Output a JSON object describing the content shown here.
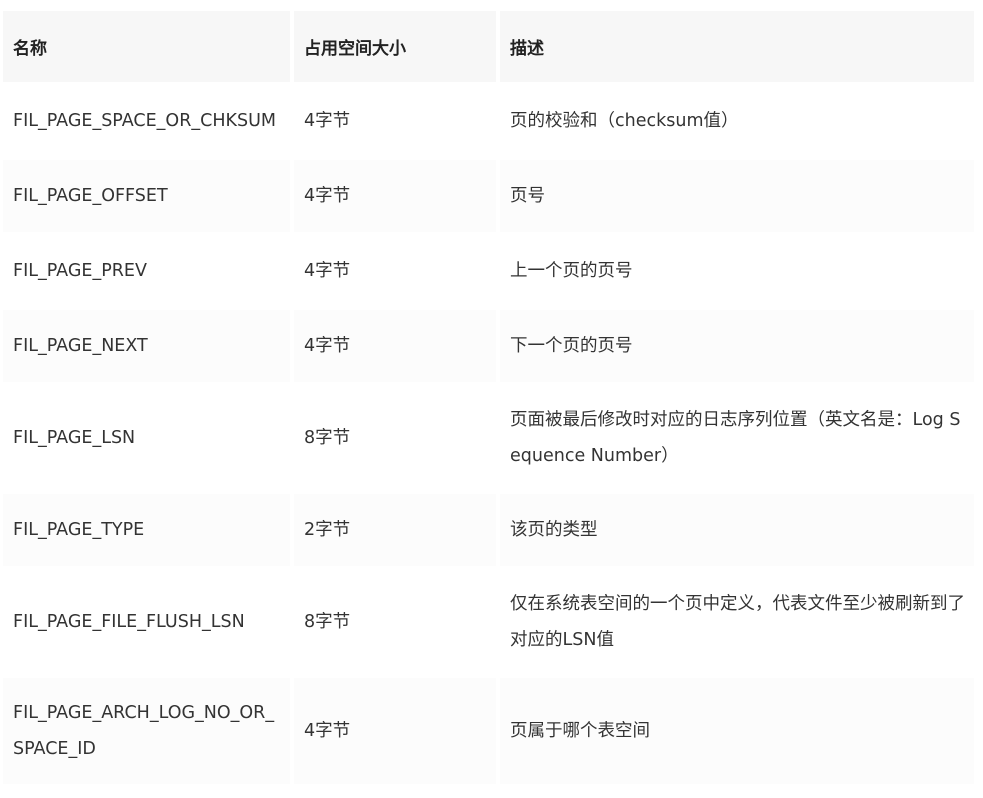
{
  "table": {
    "headers": [
      "名称",
      "占用空间大小",
      "描述"
    ],
    "rows": [
      {
        "name": "FIL_PAGE_SPACE_OR_CHKSUM",
        "size": "4字节",
        "desc": "页的校验和（checksum值）"
      },
      {
        "name": "FIL_PAGE_OFFSET",
        "size": "4字节",
        "desc": "页号"
      },
      {
        "name": "FIL_PAGE_PREV",
        "size": "4字节",
        "desc": "上一个页的页号"
      },
      {
        "name": "FIL_PAGE_NEXT",
        "size": "4字节",
        "desc": "下一个页的页号"
      },
      {
        "name": "FIL_PAGE_LSN",
        "size": "8字节",
        "desc": "页面被最后修改时对应的日志序列位置（英文名是：Log Sequence Number）"
      },
      {
        "name": "FIL_PAGE_TYPE",
        "size": "2字节",
        "desc": "该页的类型"
      },
      {
        "name": "FIL_PAGE_FILE_FLUSH_LSN",
        "size": "8字节",
        "desc": "仅在系统表空间的一个页中定义，代表文件至少被刷新到了对应的LSN值"
      },
      {
        "name": "FIL_PAGE_ARCH_LOG_NO_OR_SPACE_ID",
        "size": "4字节",
        "desc": "页属于哪个表空间"
      }
    ]
  }
}
